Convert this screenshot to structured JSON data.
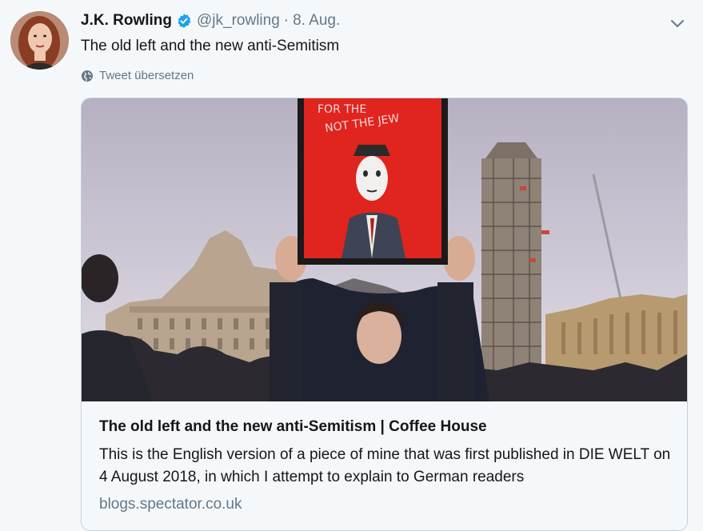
{
  "tweet": {
    "author_name": "J.K. Rowling",
    "handle": "@jk_rowling",
    "separator": "·",
    "date": "8. Aug.",
    "text": "The old left and the new anti-Semitism",
    "translate_label": "Tweet übersetzen"
  },
  "card": {
    "title": "The old left and the new anti-Semitism | Coffee House",
    "description": "This  is the English version of a piece of mine that was first published in DIE WELT on 4 August 2018, in which I attempt to explain to German readers",
    "domain": "blogs.spectator.co.uk",
    "image_sign_text_line1": "FOR THE",
    "image_sign_text_line2": "NOT THE JEW"
  },
  "icons": {
    "verified": "verified-badge-icon",
    "caret": "chevron-down-icon",
    "globe": "globe-icon"
  },
  "colors": {
    "verified_blue": "#1da1f2",
    "secondary_text": "#657786",
    "background": "#f5f8fa"
  }
}
